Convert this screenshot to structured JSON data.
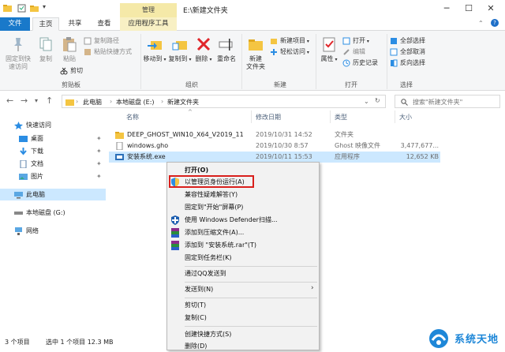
{
  "window": {
    "manage_tab": "管理",
    "title": "E:\\新建文件夹",
    "minimize": "─",
    "maximize": "☐",
    "close": "✕"
  },
  "tabs": [
    "文件",
    "主页",
    "共享",
    "查看",
    "应用程序工具"
  ],
  "ribbon": {
    "clipboard": {
      "pin": "固定到快\n速访问",
      "copy": "复制",
      "paste": "粘贴",
      "copy_path": "复制路径",
      "paste_shortcut": "粘贴快捷方式",
      "cut": "剪切",
      "label": "剪贴板"
    },
    "organize": {
      "move_to": "移动到",
      "copy_to": "复制到",
      "delete": "删除",
      "rename": "重命名",
      "label": "组织"
    },
    "new": {
      "new_folder": "新建\n文件夹",
      "new_item": "新建项目",
      "easy_access": "轻松访问",
      "label": "新建"
    },
    "open": {
      "properties": "属性",
      "open": "打开",
      "edit": "编辑",
      "history": "历史记录",
      "label": "打开"
    },
    "select": {
      "select_all": "全部选择",
      "select_none": "全部取消",
      "invert": "反向选择",
      "label": "选择"
    }
  },
  "address": {
    "crumbs": [
      "此电脑",
      "本地磁盘 (E:)",
      "新建文件夹"
    ],
    "search_placeholder": "搜索\"新建文件夹\""
  },
  "nav": {
    "quick_access": "快速访问",
    "desktop": "桌面",
    "downloads": "下载",
    "documents": "文档",
    "pictures": "图片",
    "this_pc": "此电脑",
    "local_disk": "本地磁盘 (G:)",
    "network": "网络"
  },
  "columns": [
    "名称",
    "修改日期",
    "类型",
    "大小"
  ],
  "files": [
    {
      "name": "DEEP_GHOST_WIN10_X64_V2019_11",
      "date": "2019/10/31 14:52",
      "type": "文件夹",
      "size": ""
    },
    {
      "name": "windows.gho",
      "date": "2019/10/30 8:57",
      "type": "Ghost 映像文件",
      "size": "3,477,677..."
    },
    {
      "name": "安装系统.exe",
      "date": "2019/10/11 15:53",
      "type": "应用程序",
      "size": "12,652 KB"
    }
  ],
  "context_menu": {
    "open": "打开(O)",
    "run_as_admin": "以管理员身份运行(A)",
    "compat": "兼容性疑难解答(Y)",
    "pin_start": "固定到\"开始\"屏幕(P)",
    "defender": "使用 Windows Defender扫描...",
    "add_archive": "添加到压缩文件(A)...",
    "add_rar": "添加到 \"安装系统.rar\"(T)",
    "pin_taskbar": "固定到任务栏(K)",
    "qq_send": "通过QQ发送到",
    "send_to": "发送到(N)",
    "cut": "剪切(T)",
    "copy": "复制(C)",
    "create_shortcut": "创建快捷方式(S)",
    "delete": "删除(D)"
  },
  "status": {
    "count": "3 个项目",
    "selected": "选中 1 个项目 12.3 MB"
  },
  "watermark": "系统天地"
}
